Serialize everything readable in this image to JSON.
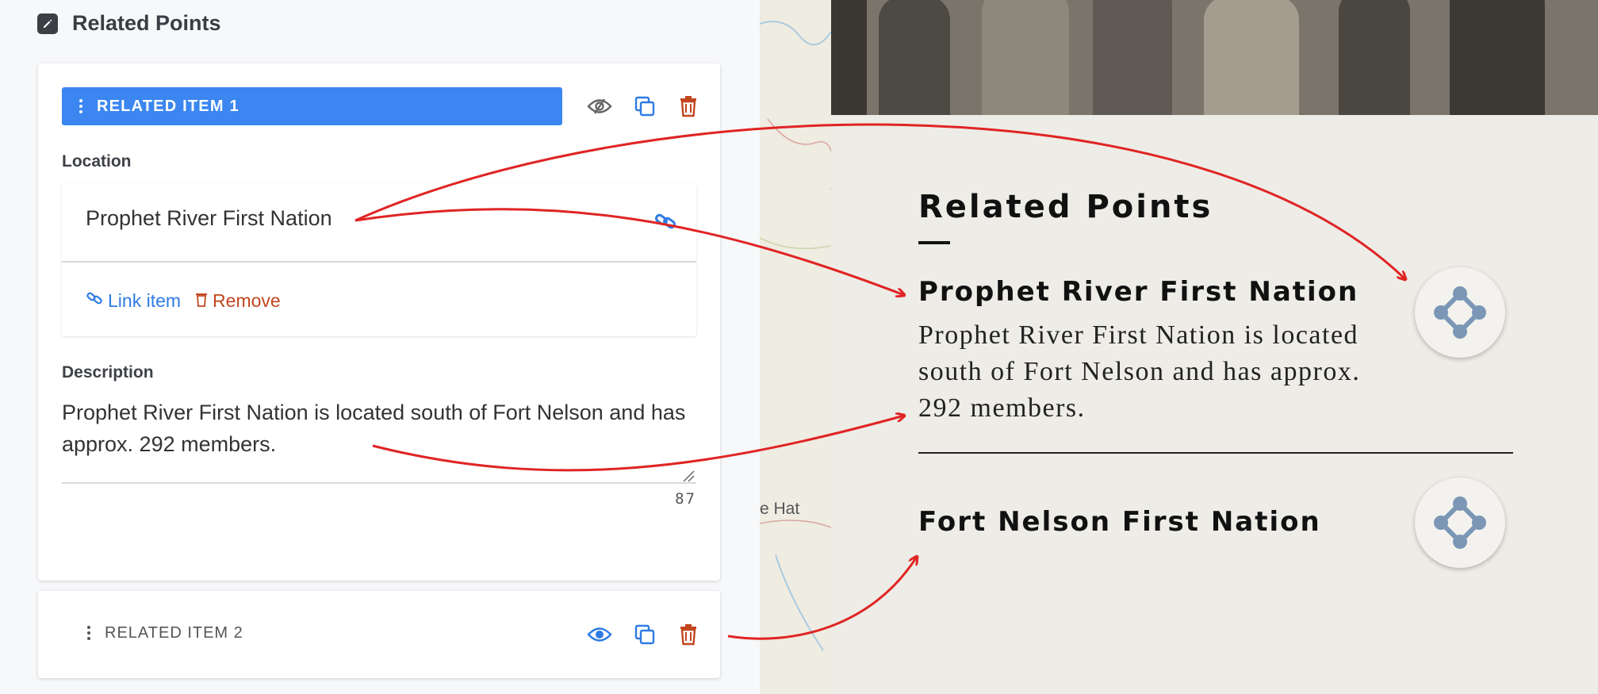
{
  "editor": {
    "section_title": "Related Points",
    "item1": {
      "label": "RELATED ITEM 1",
      "location_label": "Location",
      "location_value": "Prophet River First Nation",
      "link_item": "Link item",
      "remove": "Remove",
      "description_label": "Description",
      "description_value": "Prophet River First Nation is located south of Fort Nelson and has approx. 292 members.",
      "char_count": "87"
    },
    "item2": {
      "label": "RELATED ITEM 2"
    }
  },
  "preview": {
    "map_label": "e Hat",
    "heading": "Related Points",
    "points": [
      {
        "title": "Prophet River First Nation",
        "body": "Prophet River First Nation is located south of Fort Nelson and has approx. 292 members."
      },
      {
        "title": "Fort Nelson First Nation"
      }
    ]
  },
  "colors": {
    "accent": "#3b86f0",
    "danger": "#c2461f",
    "annotation": "#e02424"
  },
  "icons": [
    "edit-icon",
    "drag-handle-icon",
    "eye-off-icon",
    "eye-icon",
    "duplicate-icon",
    "trash-icon",
    "link-icon",
    "network-icon"
  ]
}
